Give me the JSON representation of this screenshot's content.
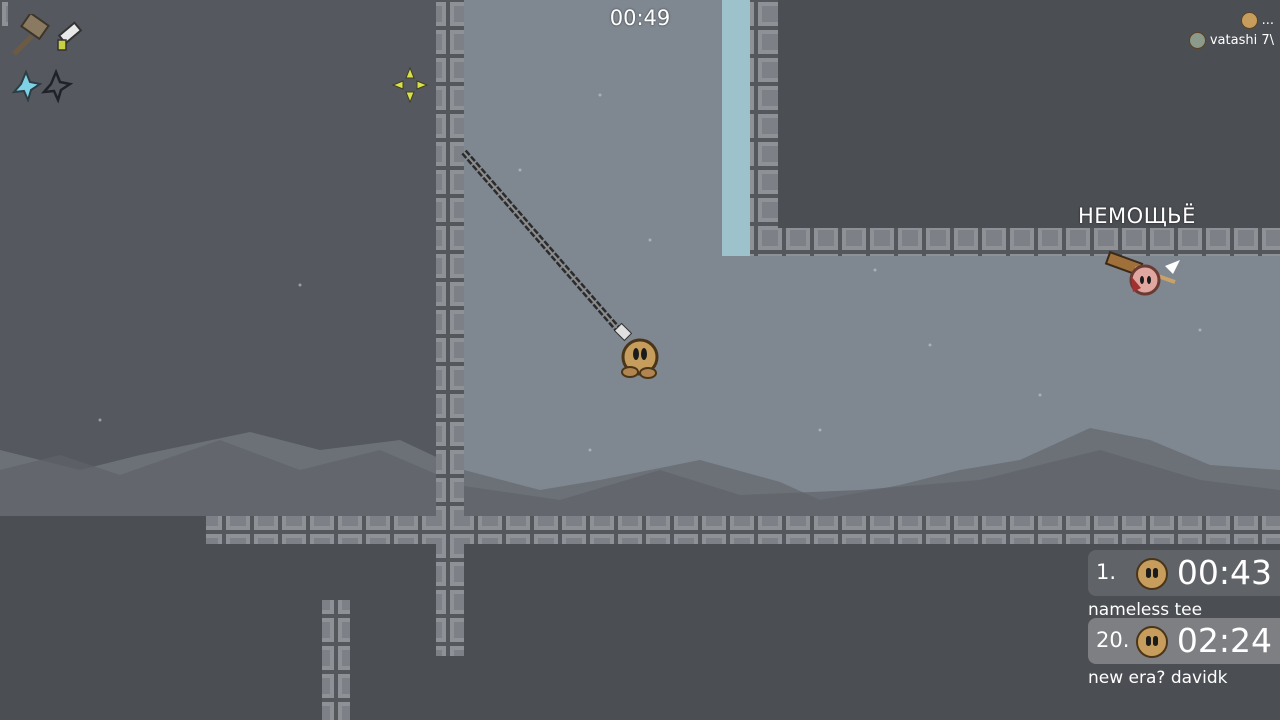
{
  "hud": {
    "race_timer": "00:49",
    "crosshair_color": "#d8e04a"
  },
  "player_list": [
    {
      "name": "...",
      "icon": "tee-icon"
    },
    {
      "name": "vatashi 7\\",
      "icon": "tee-icon"
    }
  ],
  "nameplate": "НЕМОЩЬЁ",
  "scoreboard": [
    {
      "rank": "1.",
      "time": "00:43",
      "name": "nameless tee",
      "icon": "tee-icon"
    },
    {
      "rank": "20.",
      "time": "02:24",
      "name": "new era? davidk",
      "icon": "tee-icon"
    }
  ],
  "weapons": [
    "hammer-icon",
    "gun-icon"
  ],
  "ninja_stars": [
    "star-filled-icon",
    "star-empty-icon"
  ],
  "colors": {
    "background_dark": "#4b4e53",
    "sky": "#7f8790",
    "tile": "#8e9297",
    "tile_border": "#54575c",
    "ice": "#9ec2cc",
    "tee_skin": "#c79d5d"
  }
}
